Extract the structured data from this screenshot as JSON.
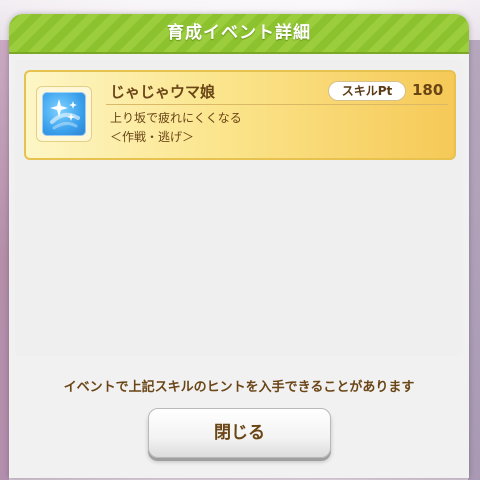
{
  "dialog": {
    "title": "育成イベント詳細",
    "header_color": "#8cc22e"
  },
  "skill": {
    "icon": "sparkle-icon",
    "name": "じゃじゃウマ娘",
    "pt_label": "スキルPt",
    "pt_value": "180",
    "description": "上り坂で疲れにくくなる",
    "condition": "＜作戦・逃げ＞"
  },
  "hint": "イベントで上記スキルのヒントを入手できることがあります",
  "buttons": {
    "close_label": "閉じる"
  }
}
